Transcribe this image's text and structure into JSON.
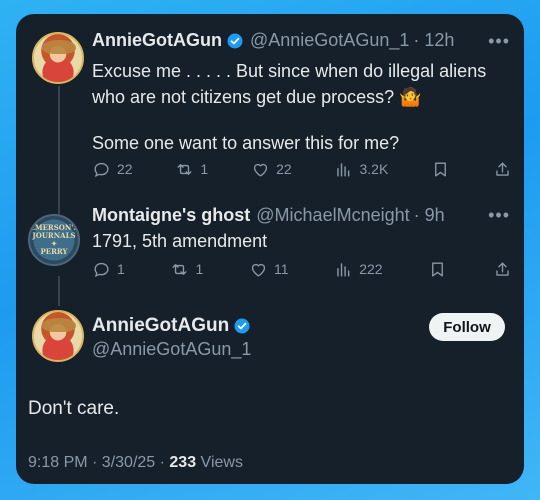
{
  "tweet1": {
    "name": "AnnieGotAGun",
    "handle": "@AnnieGotAGun_1",
    "time": "· 12h",
    "text_line1": "Excuse me . . . . . But since when do illegal aliens",
    "text_line2": "who are not citizens get due process?",
    "emoji": "🤷",
    "text_line3": "Some one want to answer this for me?",
    "replies": "22",
    "reposts": "1",
    "likes": "22",
    "views": "3.2K"
  },
  "tweet2": {
    "name": "Montaigne's ghost",
    "handle": "@MichaelMcneight",
    "time": "· 9h",
    "text": "1791, 5th amendment",
    "replies": "1",
    "reposts": "1",
    "likes": "11",
    "views": "222"
  },
  "main": {
    "name": "AnnieGotAGun",
    "handle": "@AnnieGotAGun_1",
    "follow_label": "Follow",
    "text": "Don't care.",
    "time": "9:18 PM · 3/30/25 · ",
    "views_count": "233",
    "views_label": " Views"
  },
  "icons": {
    "reply": "reply-icon",
    "repost": "repost-icon",
    "like": "heart-icon",
    "views": "views-icon",
    "bookmark": "bookmark-icon",
    "share": "share-icon",
    "verified": "verified-badge-icon",
    "more": "more-icon"
  },
  "colors": {
    "background": "#15202b",
    "text": "#e7e9ea",
    "secondary": "#8b98a5",
    "verified": "#1d9bf0",
    "outer": "#1d9bf0"
  }
}
